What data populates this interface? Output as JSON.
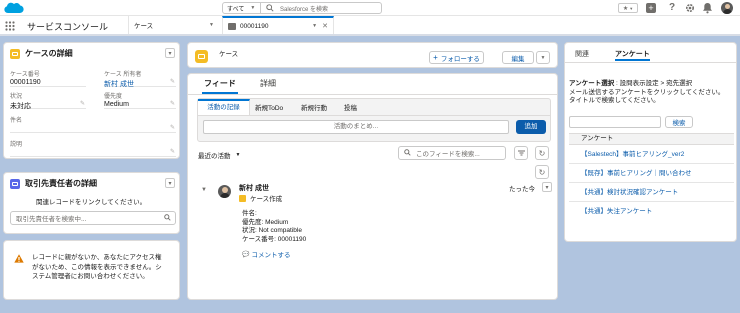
{
  "topbar": {
    "scope_label": "すべて",
    "search_placeholder": "Salesforce を検索",
    "star_glyph": "★",
    "help_glyph": "?"
  },
  "nav": {
    "app_name": "サービスコンソール",
    "tab_object": "ケース",
    "tab_record": "00001190"
  },
  "case_details": {
    "header": "ケースの詳細",
    "fields": [
      {
        "label": "ケース番号",
        "value": "00001190"
      },
      {
        "label": "ケース 所有者",
        "value": "新村 成世"
      },
      {
        "label": "状況",
        "value": "未対応"
      },
      {
        "label": "優先度",
        "value": "Medium"
      },
      {
        "label": "件名",
        "value": ""
      },
      {
        "label": "説明",
        "value": ""
      }
    ]
  },
  "contact_details": {
    "header": "取引先責任者の詳細",
    "prompt": "関連レコードをリンクしてください。",
    "search_placeholder": "取引先責任者を検索中..."
  },
  "access_warning": {
    "text": "レコードに親がないか、あなたにアクセス権がないため、この情報を表示できません。システム管理者にお問い合わせください。"
  },
  "record_header": {
    "object_label": "ケース",
    "follow_label": "フォローする",
    "edit_label": "編集"
  },
  "tabs": {
    "feed": "フィード",
    "details": "詳細"
  },
  "publisher": {
    "tabs": [
      "活動の記録",
      "新規ToDo",
      "新規行動",
      "投稿"
    ],
    "input_placeholder": "活動のまとめ...",
    "add_label": "追加"
  },
  "feed_controls": {
    "sort_label": "最近の活動",
    "search_placeholder": "このフィードを検索..."
  },
  "feed_item": {
    "author": "新村 成世",
    "action": "ケース作成",
    "timestamp": "たった今",
    "lines": [
      "件名:",
      "優先度: Medium",
      "状況: Not compatible",
      "ケース番号: 00001190"
    ],
    "comment_label": "コメントする"
  },
  "right_panel": {
    "tabs": [
      "関連",
      "アンケート"
    ],
    "instruction_title": "アンケート選択",
    "instruction_body": " : 設問表示設定 > 宛先選択",
    "instruction_lines": [
      "メール送信するアンケートをクリックしてください。",
      "タイトルで検索してください。"
    ],
    "search_button": "検索",
    "list_header": "アンケート",
    "surveys": [
      "【Salestech】事前ヒアリング_ver2",
      "【既存】事前ヒアリング｜問い合わせ",
      "【共通】検討状況確認アンケート",
      "【共通】失注アンケート"
    ]
  },
  "colors": {
    "brand": "#0176d3",
    "link": "#0b5cab",
    "active_tab": "#0b5cab",
    "case_icon": "#f4bc25",
    "contact_icon": "#5867e8"
  }
}
